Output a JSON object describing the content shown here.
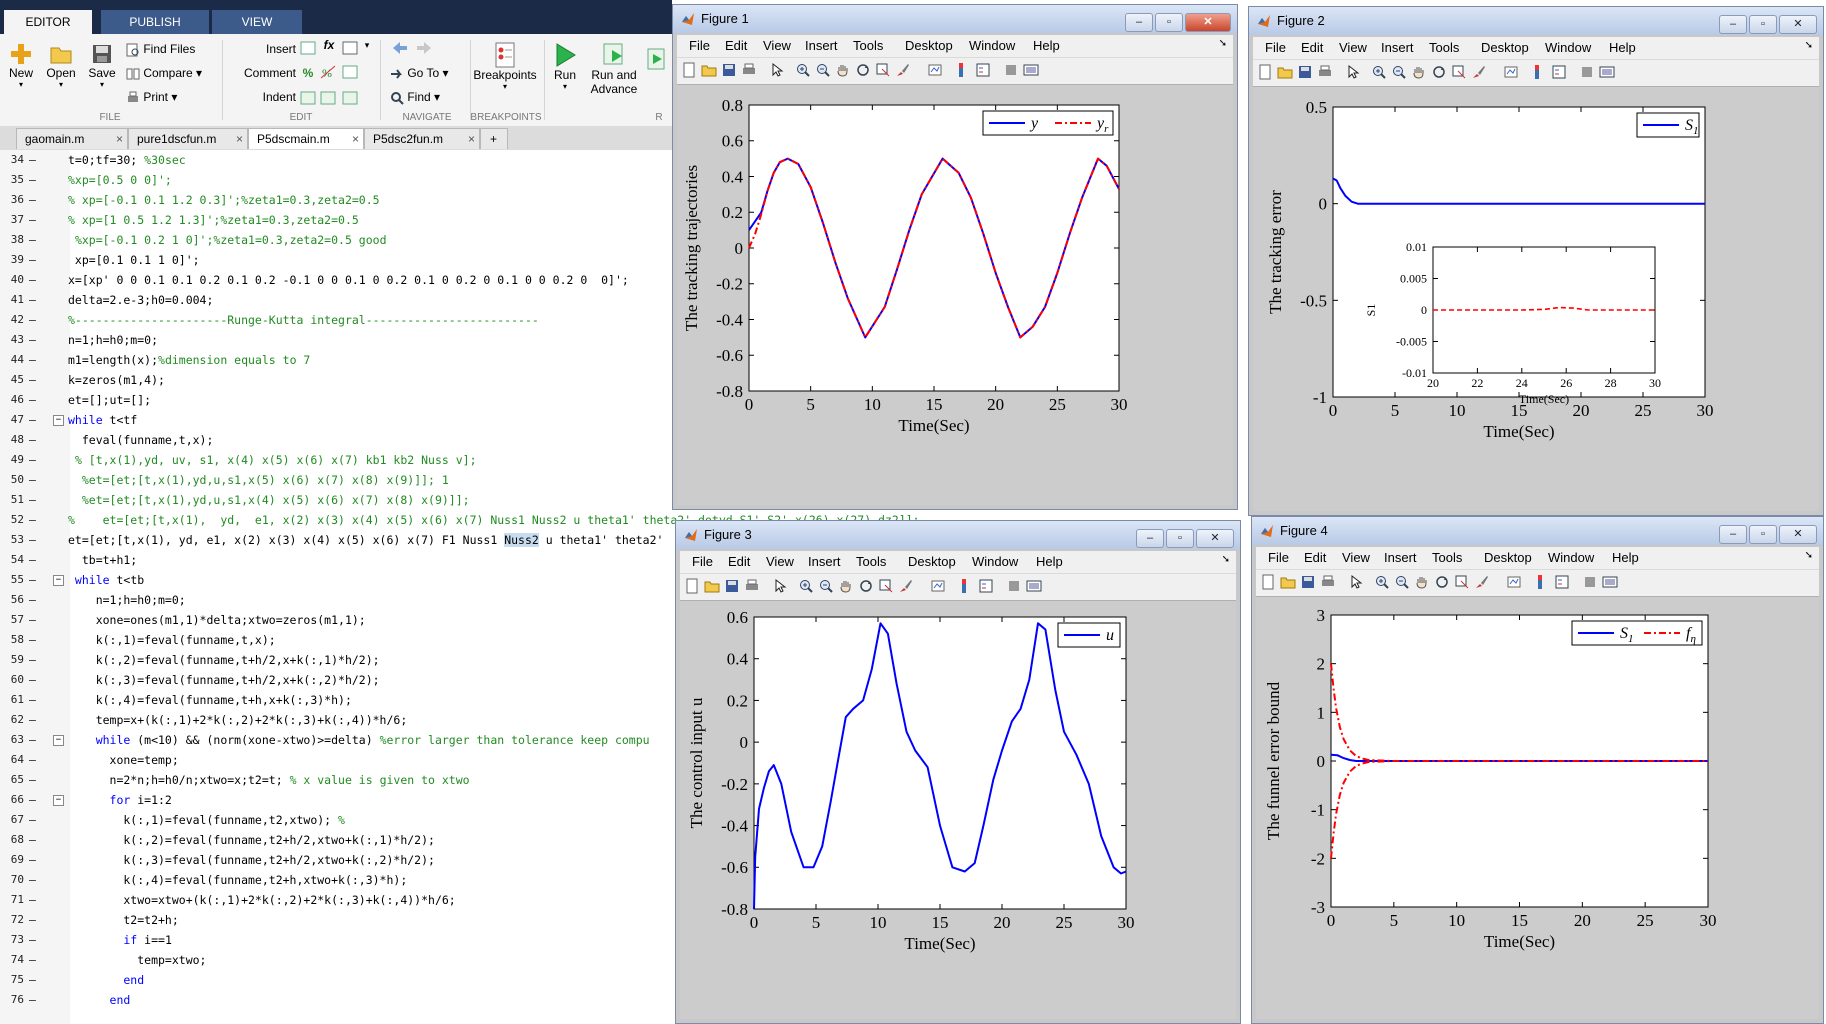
{
  "ribbon": {
    "tabs": [
      "EDITOR",
      "PUBLISH",
      "VIEW"
    ],
    "file": {
      "new": "New",
      "open": "Open",
      "save": "Save",
      "find_files": "Find Files",
      "compare": "Compare",
      "print": "Print",
      "group": "FILE"
    },
    "edit": {
      "insert": "Insert",
      "comment": "Comment",
      "indent": "Indent",
      "fx": "fx",
      "group": "EDIT"
    },
    "navigate": {
      "go_to": "Go To",
      "find": "Find",
      "group": "NAVIGATE"
    },
    "breakpoints": {
      "label": "Breakpoints",
      "group": "BREAKPOINTS"
    },
    "run": {
      "run": "Run",
      "run_advance_1": "Run and",
      "run_advance_2": "Advance",
      "group": "R"
    }
  },
  "file_tabs": [
    {
      "label": "gaomain.m",
      "active": false
    },
    {
      "label": "pure1dscfun.m",
      "active": false
    },
    {
      "label": "P5dscmain.m",
      "active": true
    },
    {
      "label": "P5dsc2fun.m",
      "active": false
    }
  ],
  "editor": {
    "lines": [
      {
        "n": "34",
        "text": "t=0;tf=30; ",
        "comment": "%30sec",
        "indent": 0
      },
      {
        "n": "35",
        "text": "",
        "comment": "%xp=[0.5 0 0]';",
        "indent": 0
      },
      {
        "n": "36",
        "text": "",
        "comment": "% xp=[-0.1 0.1 1.2 0.3]';%zeta1=0.3,zeta2=0.5",
        "indent": 0
      },
      {
        "n": "37",
        "text": "",
        "comment": "% xp=[1 0.5 1.2 1.3]';%zeta1=0.3,zeta2=0.5",
        "indent": 0
      },
      {
        "n": "38",
        "text": " ",
        "comment": "%xp=[-0.1 0.2 1 0]';%zeta1=0.3,zeta2=0.5 good",
        "indent": 0
      },
      {
        "n": "39",
        "text": " xp=[0.1 0.1 1 0]';",
        "comment": "",
        "indent": 0
      },
      {
        "n": "40",
        "text": "x=[xp' 0 0 0.1 0.1 0.2 0.1 0.2 -0.1 0 0 0.1 0 0.2 0.1 0 0.2 0 0.1 0 0 0.2 0  0]';",
        "comment": "",
        "indent": 0
      },
      {
        "n": "41",
        "text": "delta=2.e-3;h0=0.004;",
        "comment": "",
        "indent": 0
      },
      {
        "n": "42",
        "text": "",
        "comment": "%----------------------Runge-Kutta integral-------------------------",
        "indent": 0
      },
      {
        "n": "43",
        "text": "n=1;h=h0;m=0;",
        "comment": "",
        "indent": 0
      },
      {
        "n": "44",
        "text": "m1=length(x);",
        "comment": "%dimension equals to 7",
        "indent": 0
      },
      {
        "n": "45",
        "text": "k=zeros(m1,4);",
        "comment": "",
        "indent": 0
      },
      {
        "n": "46",
        "text": "et=[];ut=[];",
        "comment": "",
        "indent": 0
      },
      {
        "n": "47",
        "kw": "while",
        "text": " t<tf",
        "comment": "",
        "indent": 0,
        "fold": true
      },
      {
        "n": "48",
        "text": "  feval(funname,t,x);",
        "comment": "",
        "indent": 0
      },
      {
        "n": "49",
        "text": " ",
        "comment": "% [t,x(1),yd, uv, s1, x(4) x(5) x(6) x(7) kb1 kb2 Nuss v];",
        "indent": 0
      },
      {
        "n": "50",
        "text": "  ",
        "comment": "%et=[et;[t,x(1),yd,u,s1,x(5) x(6) x(7) x(8) x(9)]]; 1",
        "indent": 0
      },
      {
        "n": "51",
        "text": "  ",
        "comment": "%et=[et;[t,x(1),yd,u,s1,x(4) x(5) x(6) x(7) x(8) x(9)]];",
        "indent": 0
      },
      {
        "n": "52",
        "text": "",
        "comment": "%    et=[et;[t,x(1),  yd,  e1, x(2) x(3) x(4) x(5) x(6) x(7) Nuss1 Nuss2 u theta1' theta2' dotyd S1' S2' x(26) x(27) dz2]];",
        "indent": 0
      },
      {
        "n": "53",
        "text": "et=[et;[t,x(1), yd, e1, x(2) x(3) x(4) x(5) x(6) x(7) F1 Nuss1 ",
        "hl": "Nuss2",
        "tail": " u theta1' theta2'",
        "comment": "",
        "indent": 0
      },
      {
        "n": "54",
        "text": "  tb=t+h1;",
        "comment": "",
        "indent": 0
      },
      {
        "n": "55",
        "kw": " while",
        "text": " t<tb",
        "comment": "",
        "indent": 0,
        "fold": true
      },
      {
        "n": "56",
        "text": "    n=1;h=h0;m=0;",
        "comment": "",
        "indent": 0
      },
      {
        "n": "57",
        "text": "    xone=ones(m1,1)*delta;xtwo=zeros(m1,1);",
        "comment": "",
        "indent": 0
      },
      {
        "n": "58",
        "text": "    k(:,1)=feval(funname,t,x);",
        "comment": "",
        "indent": 0
      },
      {
        "n": "59",
        "text": "    k(:,2)=feval(funname,t+h/2,x+k(:,1)*h/2);",
        "comment": "",
        "indent": 0
      },
      {
        "n": "60",
        "text": "    k(:,3)=feval(funname,t+h/2,x+k(:,2)*h/2);",
        "comment": "",
        "indent": 0
      },
      {
        "n": "61",
        "text": "    k(:,4)=feval(funname,t+h,x+k(:,3)*h);",
        "comment": "",
        "indent": 0
      },
      {
        "n": "62",
        "text": "    temp=x+(k(:,1)+2*k(:,2)+2*k(:,3)+k(:,4))*h/6;",
        "comment": "",
        "indent": 0
      },
      {
        "n": "63",
        "kw": "    while",
        "text": " (m<10) && (norm(xone-xtwo)>=delta) ",
        "comment": "%error larger than tolerance keep compu",
        "indent": 0,
        "fold": true
      },
      {
        "n": "64",
        "text": "      xone=temp;",
        "comment": "",
        "indent": 0
      },
      {
        "n": "65",
        "text": "      n=2*n;h=h0/n;xtwo=x;t2=t; ",
        "comment": "% x value is given to xtwo",
        "indent": 0
      },
      {
        "n": "66",
        "kw": "      for",
        "text": " i=1:2",
        "comment": "",
        "indent": 0,
        "fold": true
      },
      {
        "n": "67",
        "text": "        k(:,1)=feval(funname,t2,xtwo); ",
        "comment": "%",
        "indent": 0
      },
      {
        "n": "68",
        "text": "        k(:,2)=feval(funname,t2+h/2,xtwo+k(:,1)*h/2);",
        "comment": "",
        "indent": 0
      },
      {
        "n": "69",
        "text": "        k(:,3)=feval(funname,t2+h/2,xtwo+k(:,2)*h/2);",
        "comment": "",
        "indent": 0
      },
      {
        "n": "70",
        "text": "        k(:,4)=feval(funname,t2+h,xtwo+k(:,3)*h);",
        "comment": "",
        "indent": 0
      },
      {
        "n": "71",
        "text": "        xtwo=xtwo+(k(:,1)+2*k(:,2)+2*k(:,3)+k(:,4))*h/6;",
        "comment": "",
        "indent": 0
      },
      {
        "n": "72",
        "text": "        t2=t2+h;",
        "comment": "",
        "indent": 0
      },
      {
        "n": "73",
        "kw": "        if",
        "text": " i==1",
        "comment": "",
        "indent": 0
      },
      {
        "n": "74",
        "text": "          temp=xtwo;",
        "comment": "",
        "indent": 0
      },
      {
        "n": "75",
        "kw": "        end",
        "text": "",
        "comment": "",
        "indent": 0
      },
      {
        "n": "76",
        "kw": "      end",
        "text": "",
        "comment": "",
        "indent": 0
      }
    ]
  },
  "figure_menu": [
    "File",
    "Edit",
    "View",
    "Insert",
    "Tools",
    "Desktop",
    "Window",
    "Help"
  ],
  "figures": [
    {
      "title": "Figure 1",
      "window_buttons": [
        "–",
        "▫",
        "✕"
      ]
    },
    {
      "title": "Figure 2",
      "window_buttons": [
        "–",
        "▫",
        "✕"
      ]
    },
    {
      "title": "Figure 3",
      "window_buttons": [
        "–",
        "▫",
        "✕"
      ]
    },
    {
      "title": "Figure 4",
      "window_buttons": [
        "–",
        "▫",
        "✕"
      ]
    }
  ],
  "chart_data": [
    {
      "type": "line",
      "figure": "Figure 1",
      "xlabel": "Time(Sec)",
      "ylabel": "The tracking trajectories",
      "xlim": [
        0,
        30
      ],
      "ylim": [
        -0.8,
        0.8
      ],
      "xticks": [
        "0",
        "5",
        "10",
        "15",
        "20",
        "25",
        "30"
      ],
      "yticks": [
        "0.8",
        "0.6",
        "0.4",
        "0.2",
        "0",
        "-0.2",
        "-0.4",
        "-0.6",
        "-0.8"
      ],
      "legend": "top-right",
      "series": [
        {
          "name": "y",
          "color": "#0000ff",
          "style": "solid",
          "x": [
            0,
            0.5,
            1,
            1.5,
            2,
            2.5,
            3.14,
            4,
            5,
            6,
            7,
            8,
            9.42,
            11,
            12,
            13,
            14,
            15.7,
            17,
            18,
            19,
            20,
            21,
            22,
            23,
            24,
            25,
            26,
            27,
            28.3,
            29,
            30
          ],
          "values": [
            0.1,
            0.15,
            0.2,
            0.32,
            0.42,
            0.48,
            0.5,
            0.47,
            0.34,
            0.14,
            -0.08,
            -0.28,
            -0.5,
            -0.33,
            -0.12,
            0.1,
            0.3,
            0.5,
            0.42,
            0.28,
            0.08,
            -0.14,
            -0.33,
            -0.5,
            -0.44,
            -0.33,
            -0.14,
            0.08,
            0.28,
            0.5,
            0.46,
            0.33
          ]
        },
        {
          "name": "y_r",
          "color": "#ff0000",
          "style": "dashdot",
          "x": [
            0,
            0.5,
            1,
            1.5,
            2,
            2.5,
            3.14,
            4,
            5,
            6,
            7,
            8,
            9.42,
            11,
            12,
            13,
            14,
            15.7,
            17,
            18,
            19,
            20,
            21,
            22,
            23,
            24,
            25,
            26,
            27,
            28.3,
            29,
            30
          ],
          "values": [
            0.0,
            0.08,
            0.19,
            0.32,
            0.42,
            0.48,
            0.5,
            0.47,
            0.34,
            0.14,
            -0.08,
            -0.28,
            -0.5,
            -0.33,
            -0.12,
            0.1,
            0.3,
            0.5,
            0.42,
            0.28,
            0.08,
            -0.14,
            -0.33,
            -0.5,
            -0.44,
            -0.33,
            -0.14,
            0.08,
            0.28,
            0.5,
            0.46,
            0.33
          ]
        }
      ]
    },
    {
      "type": "line",
      "figure": "Figure 2",
      "xlabel": "Time(Sec)",
      "ylabel": "The tracking error",
      "xlim": [
        0,
        30
      ],
      "ylim": [
        -1,
        0.5
      ],
      "xticks": [
        "0",
        "5",
        "10",
        "15",
        "20",
        "25",
        "30"
      ],
      "yticks": [
        "0.5",
        "0",
        "-0.5",
        "-1"
      ],
      "legend": "top-right",
      "series": [
        {
          "name": "S_1",
          "color": "#0000ff",
          "style": "solid",
          "x": [
            0,
            0.3,
            0.6,
            1,
            1.5,
            2,
            3,
            5,
            10,
            15,
            20,
            25,
            30
          ],
          "values": [
            0.13,
            0.12,
            0.08,
            0.04,
            0.01,
            0.0,
            0.0,
            0.0,
            0.0,
            0.0,
            0.0,
            0.0,
            0.0
          ]
        }
      ],
      "inset": {
        "xlabel": "Time(Sec)",
        "ylabel": "S1",
        "xlim": [
          20,
          30
        ],
        "ylim": [
          -0.01,
          0.01
        ],
        "xticks": [
          "20",
          "22",
          "24",
          "26",
          "28",
          "30"
        ],
        "yticks": [
          "0.01",
          "0.005",
          "0",
          "-0.005",
          "-0.01"
        ],
        "series": [
          {
            "name": "S1",
            "color": "#ff0000",
            "style": "dashed",
            "x": [
              20,
              22,
              24,
              25,
              25.7,
              26.3,
              27,
              28,
              30
            ],
            "values": [
              0.0,
              0.0,
              0.0,
              0.0001,
              0.0004,
              0.0003,
              0.0,
              0.0,
              0.0
            ]
          }
        ]
      }
    },
    {
      "type": "line",
      "figure": "Figure 3",
      "xlabel": "Time(Sec)",
      "ylabel": "The control input u",
      "xlim": [
        0,
        30
      ],
      "ylim": [
        -0.8,
        0.6
      ],
      "xticks": [
        "0",
        "5",
        "10",
        "15",
        "20",
        "25",
        "30"
      ],
      "yticks": [
        "0.6",
        "0.4",
        "0.2",
        "0",
        "-0.2",
        "-0.4",
        "-0.6",
        "-0.8"
      ],
      "legend": "top-right",
      "series": [
        {
          "name": "u",
          "color": "#0000ff",
          "style": "solid",
          "x": [
            0,
            0.1,
            0.4,
            0.8,
            1.2,
            1.6,
            2.2,
            3,
            4,
            4.8,
            5.5,
            6.2,
            6.8,
            7.4,
            8,
            8.8,
            9.5,
            10.2,
            10.8,
            11.5,
            12.3,
            13,
            14,
            15,
            16,
            17,
            17.8,
            18.5,
            19.3,
            20,
            20.8,
            21.5,
            22.2,
            22.9,
            23.5,
            24.3,
            25,
            26,
            27,
            28,
            29,
            29.6,
            30
          ],
          "values": [
            -0.8,
            -0.55,
            -0.32,
            -0.22,
            -0.14,
            -0.11,
            -0.2,
            -0.43,
            -0.6,
            -0.6,
            -0.5,
            -0.28,
            -0.08,
            0.12,
            0.16,
            0.2,
            0.35,
            0.57,
            0.52,
            0.28,
            0.05,
            -0.04,
            -0.12,
            -0.4,
            -0.6,
            -0.62,
            -0.58,
            -0.4,
            -0.18,
            -0.04,
            0.1,
            0.16,
            0.3,
            0.57,
            0.54,
            0.25,
            0.05,
            -0.06,
            -0.2,
            -0.45,
            -0.6,
            -0.63,
            -0.62
          ]
        }
      ]
    },
    {
      "type": "line",
      "figure": "Figure 4",
      "xlabel": "Time(Sec)",
      "ylabel": "The funnel error bound",
      "xlim": [
        0,
        30
      ],
      "ylim": [
        -3,
        3
      ],
      "xticks": [
        "0",
        "5",
        "10",
        "15",
        "20",
        "25",
        "30"
      ],
      "yticks": [
        "3",
        "2",
        "1",
        "0",
        "-1",
        "-2",
        "-3"
      ],
      "legend": "top-right",
      "series": [
        {
          "name": "S_1",
          "color": "#0000ff",
          "style": "solid",
          "x": [
            0,
            0.5,
            1,
            1.5,
            2,
            3,
            5,
            10,
            15,
            20,
            25,
            30
          ],
          "values": [
            0.13,
            0.12,
            0.06,
            0.02,
            0.0,
            0.0,
            0.0,
            0.0,
            0.0,
            0.0,
            0.0,
            0.0
          ]
        },
        {
          "name": "f_η",
          "color": "#ff0000",
          "style": "dashdot",
          "x": [
            0,
            0.2,
            0.4,
            0.7,
            1,
            1.5,
            2,
            2.5,
            3,
            4,
            5,
            10,
            20,
            30
          ],
          "values": [
            2.0,
            1.5,
            1.1,
            0.7,
            0.45,
            0.22,
            0.1,
            0.05,
            0.02,
            0.01,
            0.0,
            0.0,
            0.0,
            0.0
          ]
        },
        {
          "name": "-f_η",
          "color": "#ff0000",
          "style": "dashdot",
          "x": [
            0,
            0.2,
            0.4,
            0.7,
            1,
            1.5,
            2,
            2.5,
            3,
            4,
            5,
            10,
            20,
            30
          ],
          "values": [
            -2.0,
            -1.5,
            -1.1,
            -0.7,
            -0.45,
            -0.22,
            -0.1,
            -0.05,
            -0.02,
            -0.01,
            0.0,
            0.0,
            0.0,
            0.0
          ]
        }
      ]
    }
  ],
  "legend_labels": {
    "fig1": [
      "y",
      "y_r"
    ],
    "fig2": [
      "S_1"
    ],
    "fig3": [
      "u"
    ],
    "fig4": [
      "S_1",
      "f_η"
    ]
  }
}
